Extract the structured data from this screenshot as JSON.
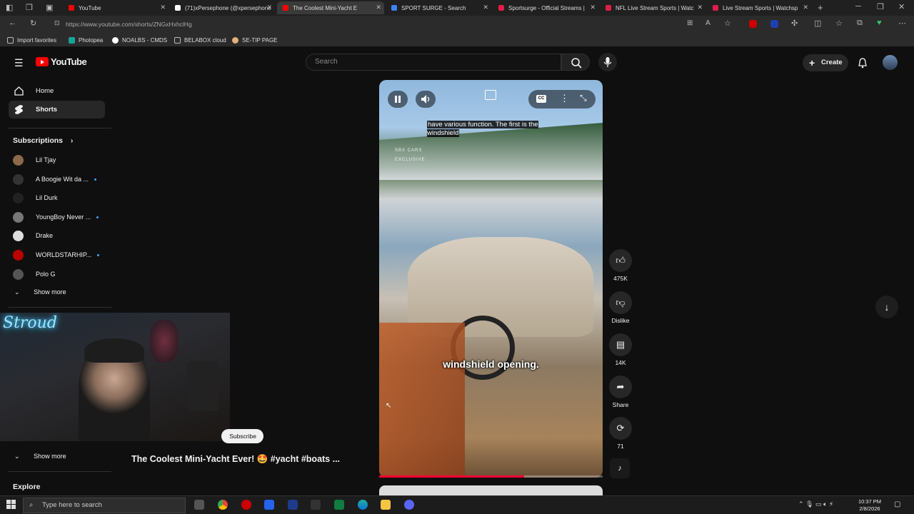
{
  "browser": {
    "tabs": [
      {
        "label": "YouTube",
        "color": "#ff0000"
      },
      {
        "label": "(71)xPersephone (@xpersephone",
        "color": "#ffffff"
      },
      {
        "label": "The Coolest Mini-Yacht E",
        "color": "#ff0000"
      },
      {
        "label": "SPORT SURGE - Search",
        "color": "#3b82f6"
      },
      {
        "label": "Sportsurge - Official Streams |",
        "color": "#e11d48"
      },
      {
        "label": "NFL Live Stream Sports | Watc",
        "color": "#e11d48"
      },
      {
        "label": "Live Stream Sports | Watchsp",
        "color": "#e11d48"
      }
    ],
    "url": "https://www.youtube.com/shorts/ZNGxHxhclHg",
    "favorites": [
      "Import favorites",
      "Photopea",
      "NOALBS - CMDS",
      "BELABOX cloud",
      "SE-TIP PAGE"
    ]
  },
  "youtube": {
    "logo": "YouTube",
    "search_placeholder": "Search",
    "create_label": "Create",
    "nav": [
      {
        "label": "Home",
        "icon": "home-icon"
      },
      {
        "label": "Shorts",
        "icon": "shorts-icon"
      }
    ],
    "subscriptions_label": "Subscriptions",
    "subscriptions": [
      {
        "label": "Lil Tjay",
        "dot": false,
        "color": "#8a6a4a"
      },
      {
        "label": "A Boogie Wit da ...",
        "dot": true,
        "color": "#333"
      },
      {
        "label": "Lil Durk",
        "dot": false,
        "color": "#222"
      },
      {
        "label": "YoungBoy Never ...",
        "dot": true,
        "color": "#777"
      },
      {
        "label": "Drake",
        "dot": false,
        "color": "#ddd"
      },
      {
        "label": "WORLDSTARHIP...",
        "dot": true,
        "color": "#b00"
      },
      {
        "label": "Polo G",
        "dot": false,
        "color": "#555"
      }
    ],
    "show_more": "Show more",
    "show_more_2": "Show more",
    "explore": "Explore",
    "subscribe": "Subscribe",
    "video": {
      "caption_top": "have various function. The first is the windshield",
      "caption_mid": "windshield opening.",
      "watermark": "SBX CARS EXCLUSIVE",
      "progress": 0.65,
      "title": "The Coolest Mini-Yacht Ever! 🤩 #yacht #boats ..."
    },
    "actions": {
      "likes": "475K",
      "dislike": "Dislike",
      "comments": "14K",
      "share": "Share",
      "remix": "71"
    },
    "webcam_logo": "Stroud"
  },
  "taskbar": {
    "search_placeholder": "Type here to search",
    "time": "10:37 PM",
    "date": "2/8/2026"
  }
}
